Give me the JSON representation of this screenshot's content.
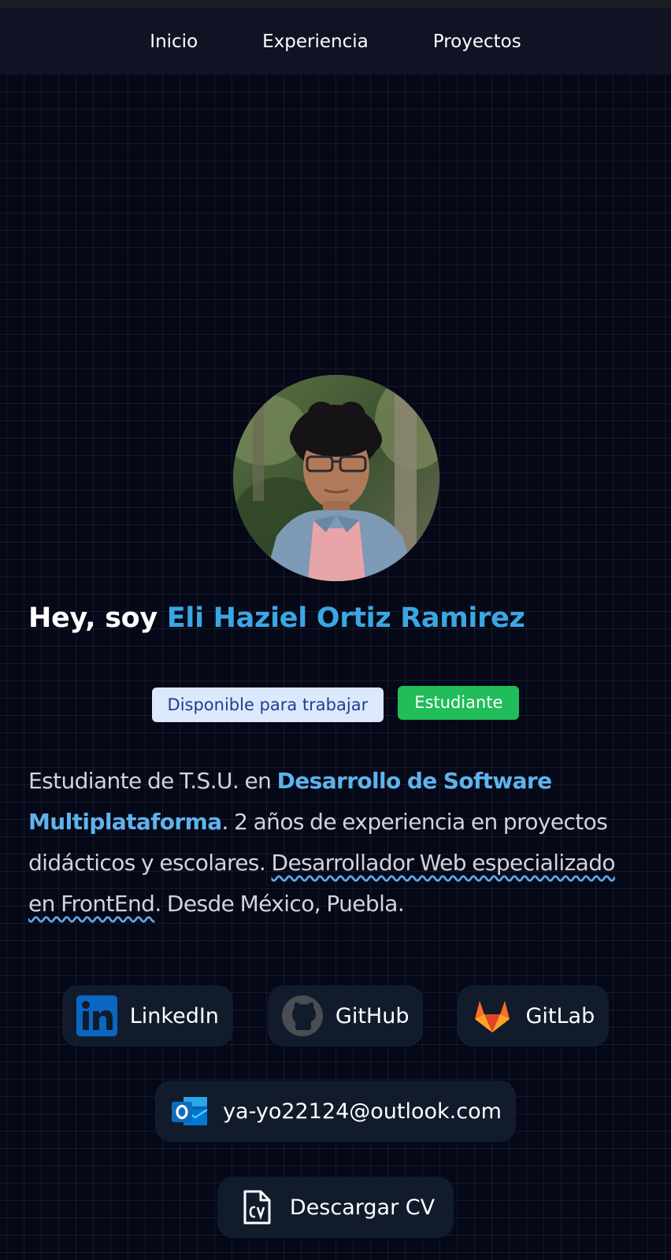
{
  "nav": {
    "items": [
      {
        "label": "Inicio"
      },
      {
        "label": "Experiencia"
      },
      {
        "label": "Proyectos"
      }
    ]
  },
  "hero": {
    "greeting": "Hey, soy",
    "name": "Eli Haziel Ortiz Ramirez",
    "badges": {
      "available": "Disponible para trabajar",
      "student": "Estudiante"
    },
    "bio": {
      "part1": "Estudiante de T.S.U. en ",
      "highlight": "Desarrollo de Software Multiplataforma",
      "part2": ". 2 años de experiencia en proyectos didácticos y escolares. ",
      "underlined": "Desarrollador Web especializado en FrontEnd",
      "part3": ". Desde México, Puebla."
    }
  },
  "links": {
    "linkedin": {
      "label": "LinkedIn",
      "icon": "linkedin-icon"
    },
    "github": {
      "label": "GitHub",
      "icon": "github-icon"
    },
    "gitlab": {
      "label": "GitLab",
      "icon": "gitlab-icon"
    },
    "email": {
      "label": "ya-yo22124@outlook.com",
      "icon": "outlook-icon"
    },
    "cv": {
      "label": "Descargar CV",
      "icon": "cv-file-icon"
    }
  },
  "colors": {
    "background": "#050817",
    "accent_name": "#3ba7e2",
    "badge_available_bg": "#dce8fc",
    "badge_student_bg": "#20bd5a",
    "pill_bg": "#121b2c"
  }
}
